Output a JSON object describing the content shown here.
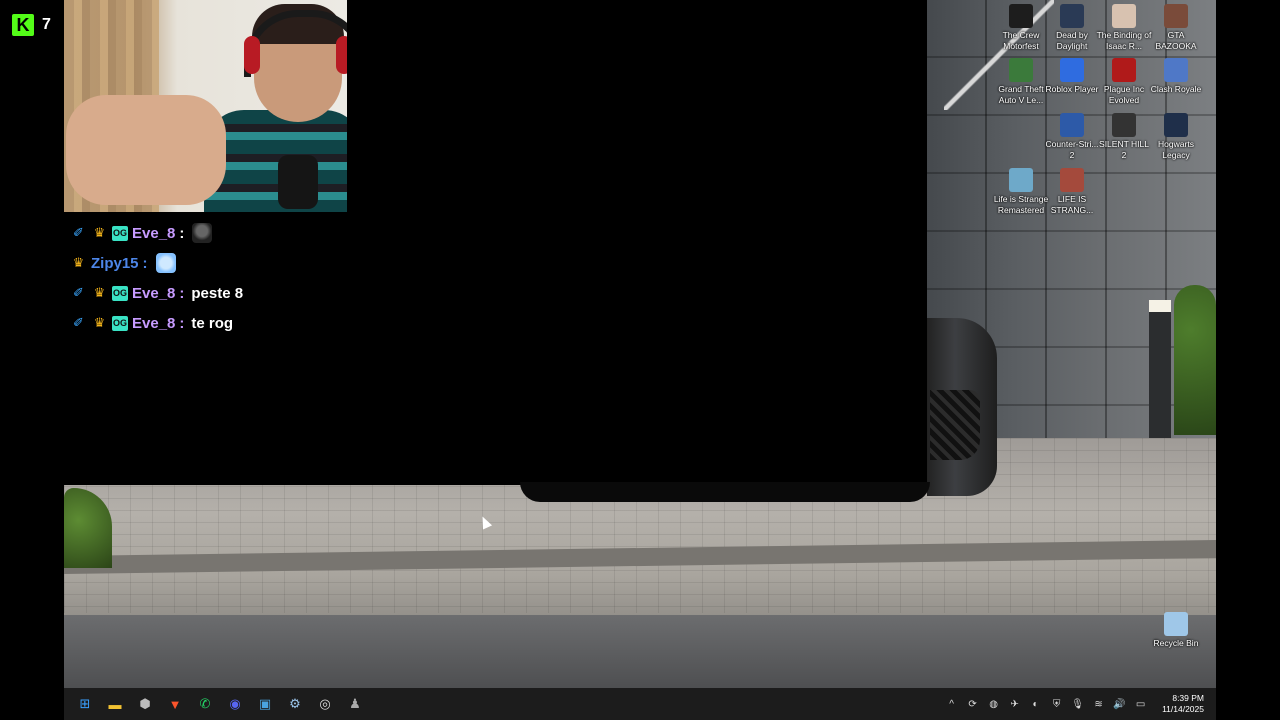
{
  "stream": {
    "viewer_count": "7"
  },
  "chat": {
    "messages": [
      {
        "user": "Eve_8",
        "user_color": "#c79bff",
        "badges": [
          "sword-icon",
          "crown-icon",
          "og-badge"
        ],
        "text": "",
        "emote": "cat-emote"
      },
      {
        "user": "Zipy15",
        "user_color": "#4d86e8",
        "badges": [
          "crown-icon"
        ],
        "text": "",
        "emote": "hand-emote"
      },
      {
        "user": "Eve_8",
        "user_color": "#c79bff",
        "badges": [
          "sword-icon",
          "crown-icon",
          "og-badge"
        ],
        "text": "peste 8"
      },
      {
        "user": "Eve_8",
        "user_color": "#c79bff",
        "badges": [
          "sword-icon",
          "crown-icon",
          "og-badge"
        ],
        "text": "te rog"
      }
    ]
  },
  "desktop": {
    "icons": [
      {
        "label": "The Crew Motorfest",
        "icon": "the-crew-motorfest-icon",
        "color": "#1d1d1d"
      },
      {
        "label": "Dead by Daylight",
        "icon": "dead-by-daylight-icon",
        "color": "#2a3a55"
      },
      {
        "label": "The Binding of Isaac R...",
        "icon": "binding-of-isaac-icon",
        "color": "#d8c2b0"
      },
      {
        "label": "GTA BAZOOKA",
        "icon": "gta-bazooka-icon",
        "color": "#7a4b3a"
      },
      {
        "label": "Grand Theft Auto V Le...",
        "icon": "gta-v-icon",
        "color": "#3b7a3b"
      },
      {
        "label": "Roblox Player",
        "icon": "roblox-icon",
        "color": "#2f6ce0"
      },
      {
        "label": "Plague Inc Evolved",
        "icon": "plague-inc-icon",
        "color": "#b01a1a"
      },
      {
        "label": "Clash Royale",
        "icon": "clash-royale-icon",
        "color": "#4f78c7"
      },
      {
        "label": "Counter-Stri... 2",
        "icon": "counter-strike-icon",
        "color": "#2d5aa8"
      },
      {
        "label": "SILENT HILL 2",
        "icon": "silent-hill-icon",
        "color": "#333"
      },
      {
        "label": "Hogwarts Legacy",
        "icon": "hogwarts-icon",
        "color": "#1f2f4a"
      },
      {
        "label": "Life is Strange Remastered",
        "icon": "life-is-strange-icon",
        "color": "#6ea9c9"
      },
      {
        "label": "LIFE IS STRANG...",
        "icon": "life-is-strange-2-icon",
        "color": "#a44a3c"
      },
      {
        "label": "Recycle Bin",
        "icon": "recycle-bin-icon",
        "color": "#9fc7e8"
      }
    ]
  },
  "taskbar": {
    "apps": [
      {
        "name": "windows-start-icon",
        "glyph": "⊞",
        "color": "#3aa0ff"
      },
      {
        "name": "file-explorer-icon",
        "glyph": "▬",
        "color": "#f2c232"
      },
      {
        "name": "app-icon",
        "glyph": "⬢",
        "color": "#bbbbbb"
      },
      {
        "name": "brave-browser-icon",
        "glyph": "▼",
        "color": "#fb542b"
      },
      {
        "name": "whatsapp-icon",
        "glyph": "✆",
        "color": "#25d366"
      },
      {
        "name": "discord-icon",
        "glyph": "◉",
        "color": "#5865f2"
      },
      {
        "name": "photos-icon",
        "glyph": "▣",
        "color": "#4aa3df"
      },
      {
        "name": "steam-icon",
        "glyph": "⚙",
        "color": "#9bc4ea"
      },
      {
        "name": "obs-icon",
        "glyph": "◎",
        "color": "#dddddd"
      },
      {
        "name": "game-icon",
        "glyph": "♟",
        "color": "#aaaaaa"
      }
    ],
    "tray": [
      {
        "name": "chevron-up-icon",
        "glyph": "^"
      },
      {
        "name": "sync-icon",
        "glyph": "⟳"
      },
      {
        "name": "steam-tray-icon",
        "glyph": "◍"
      },
      {
        "name": "tray-app-icon",
        "glyph": "✈"
      },
      {
        "name": "tray-app-2-icon",
        "glyph": "◐"
      },
      {
        "name": "shield-icon",
        "glyph": "⛨"
      },
      {
        "name": "microphone-icon",
        "glyph": "🎙"
      },
      {
        "name": "wifi-icon",
        "glyph": "≋"
      },
      {
        "name": "volume-icon",
        "glyph": "🔊"
      },
      {
        "name": "battery-icon",
        "glyph": "▭"
      }
    ],
    "time": "8:39 PM",
    "date": "11/14/2025"
  }
}
